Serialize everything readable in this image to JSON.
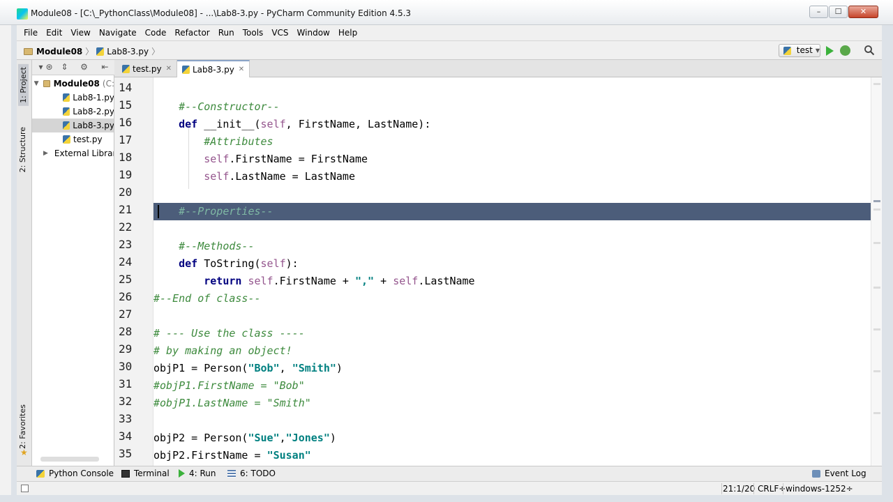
{
  "window": {
    "title": "Module08 - [C:\\_PythonClass\\Module08] - ...\\Lab8-3.py - PyCharm Community Edition 4.5.3",
    "minimize": "–",
    "maximize": "☐",
    "close": "✕"
  },
  "menu": [
    "File",
    "Edit",
    "View",
    "Navigate",
    "Code",
    "Refactor",
    "Run",
    "Tools",
    "VCS",
    "Window",
    "Help"
  ],
  "navbar": {
    "project": "Module08",
    "file": "Lab8-3.py",
    "run_config": "test"
  },
  "left_strip": {
    "project_tab": "1: Project",
    "structure_tab": "2: Structure",
    "favorites_tab": "2: Favorites"
  },
  "project_tree": {
    "root": "Module08",
    "root_suffix": "(C:",
    "files": [
      "Lab8-1.py",
      "Lab8-2.py",
      "Lab8-3.py",
      "test.py"
    ],
    "external": "External Librari"
  },
  "tabs": [
    {
      "label": "test.py",
      "active": false
    },
    {
      "label": "Lab8-3.py",
      "active": true
    }
  ],
  "editor": {
    "line_numbers": [
      "14",
      "15",
      "16",
      "17",
      "18",
      "19",
      "20",
      "21",
      "22",
      "23",
      "24",
      "25",
      "26",
      "27",
      "28",
      "29",
      "30",
      "31",
      "32",
      "33",
      "34",
      "35"
    ],
    "current_line": "21"
  },
  "bottom_tools": {
    "python_console": "Python Console",
    "terminal": "Terminal",
    "run": "4: Run",
    "todo": "6: TODO",
    "event_log": "Event Log"
  },
  "status": {
    "position": "21:1/20",
    "line_sep": "CRLF÷",
    "encoding": "windows-1252÷"
  },
  "colors": {
    "comment": "#3d8a3d",
    "keyword": "#000080",
    "self": "#94558d",
    "string": "#008080",
    "current_line_bg": "#4c5d7a"
  }
}
